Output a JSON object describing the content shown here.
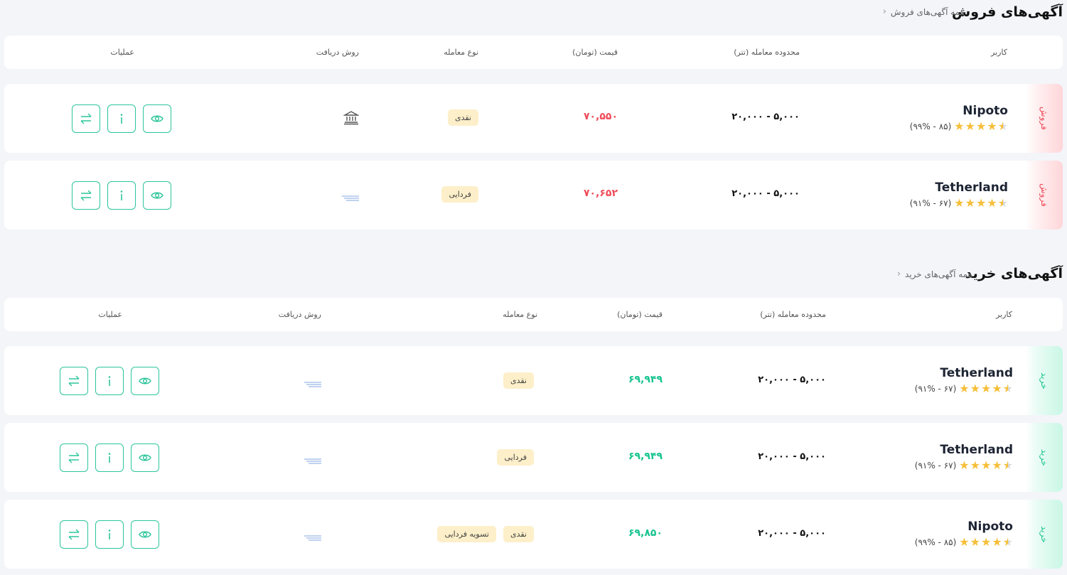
{
  "sell": {
    "title": "آگهی‌های فروش",
    "all_link": "همه آگهی‌های فروش",
    "headers": {
      "user": "کاربر",
      "range": "محدوده معامله (تتر)",
      "price": "قیمت (تومان)",
      "type": "نوع معامله",
      "method": "روش دریافت",
      "ops": "عملیات"
    },
    "rows": [
      {
        "side": "فروش",
        "name": "Nipoto",
        "rating": "(۹۹% - ۸۵)",
        "range": "۲۰,۰۰۰ - ۵,۰۰۰",
        "price": "۷۰,۵۵۰",
        "tags": [
          "نقدی"
        ],
        "method_icon": "bank-icon"
      },
      {
        "side": "فروش",
        "name": "Tetherland",
        "rating": "(۹۱% - ۶۷)",
        "range": "۲۰,۰۰۰ - ۵,۰۰۰",
        "price": "۷۰,۶۵۲",
        "tags": [
          "فردایی"
        ],
        "method_icon": "card-transfer-icon"
      }
    ]
  },
  "buy": {
    "title": "آگهی‌های خرید",
    "all_link": "همه آگهی‌های خرید",
    "headers": {
      "user": "کاربر",
      "range": "محدوده معامله (تتر)",
      "price": "قیمت (تومان)",
      "type": "نوع معامله",
      "method": "روش دریافت",
      "ops": "عملیات"
    },
    "rows": [
      {
        "side": "خرید",
        "name": "Tetherland",
        "rating": "(۹۱% - ۶۷)",
        "range": "۲۰,۰۰۰ - ۵,۰۰۰",
        "price": "۶۹,۹۴۹",
        "tags": [
          "نقدی"
        ],
        "method_icon": "card-transfer-icon"
      },
      {
        "side": "خرید",
        "name": "Tetherland",
        "rating": "(۹۱% - ۶۷)",
        "range": "۲۰,۰۰۰ - ۵,۰۰۰",
        "price": "۶۹,۹۴۹",
        "tags": [
          "فردایی"
        ],
        "method_icon": "card-transfer-icon"
      },
      {
        "side": "خرید",
        "name": "Nipoto",
        "rating": "(۹۹% - ۸۵)",
        "range": "۲۰,۰۰۰ - ۵,۰۰۰",
        "price": "۶۹,۸۵۰",
        "tags": [
          "نقدی",
          "تسویه فردایی"
        ],
        "method_icon": "card-transfer-icon"
      }
    ]
  },
  "colors": {
    "sell_accent": "#ef4d5b",
    "buy_accent": "#18c48f",
    "button_border": "#2cc59b",
    "tag_bg": "#fdefc9",
    "star": "#f6bf3a"
  },
  "icons": {
    "stars": "star-icon",
    "actions": [
      "transfer-icon",
      "info-icon",
      "eye-icon"
    ]
  }
}
